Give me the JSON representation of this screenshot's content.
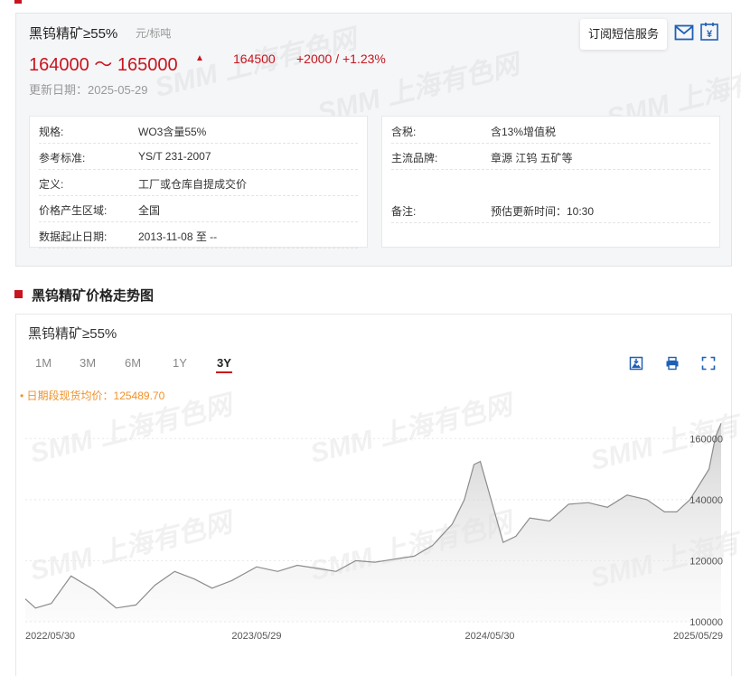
{
  "product": {
    "title": "黑钨精矿≥55%",
    "unit": "元/标吨",
    "price_range": "164000 ～ 165000",
    "avg_price": "164500",
    "change": "+2000 / +1.23%",
    "update_date": "更新日期：2025-05-29",
    "subscribe_label": "订阅短信服务"
  },
  "specs_left": [
    {
      "key": "规格:",
      "value": "WO3含量55%"
    },
    {
      "key": "参考标准:",
      "value": "YS/T 231-2007"
    },
    {
      "key": "定义:",
      "value": "工厂或仓库自提成交价"
    },
    {
      "key": "价格产生区域:",
      "value": "全国"
    },
    {
      "key": "数据起止日期:",
      "value": "2013-11-08 至 --"
    }
  ],
  "specs_right": [
    {
      "key": "含税:",
      "value": "含13%增值税"
    },
    {
      "key": "主流品牌:",
      "value": "章源 江钨 五矿等"
    },
    {
      "key": "备注:",
      "value": "预估更新时间：10:30"
    }
  ],
  "section_title": "黑钨精矿价格走势图",
  "chart_panel": {
    "title": "黑钨精矿≥55%",
    "ranges": [
      "1M",
      "3M",
      "6M",
      "1Y",
      "3Y"
    ],
    "active_range": "3Y",
    "avg_note": "• 日期段现货均价：125489.70",
    "watermark": "SMM 上海有色网"
  },
  "colors": {
    "accent": "#c8141e",
    "note": "#f0922a",
    "line": "#8c8c8c"
  },
  "chart_data": {
    "type": "area",
    "x_ticks": [
      "2022/05/30",
      "2023/05/29",
      "2024/05/30",
      "2025/05/29"
    ],
    "y_ticks": [
      100000,
      120000,
      140000,
      160000
    ],
    "ylim": [
      100000,
      166000
    ],
    "grid": true,
    "series": [
      {
        "x": [
          "2022/05/30",
          "2022/06/15",
          "2022/07/10",
          "2022/08/10",
          "2022/09/15",
          "2022/10/20",
          "2022/11/20",
          "2022/12/20",
          "2023/01/20",
          "2023/02/20",
          "2023/03/20",
          "2023/04/20",
          "2023/05/29",
          "2023/07/01",
          "2023/08/01",
          "2023/09/01",
          "2023/10/01",
          "2023/11/01",
          "2023/12/01",
          "2024/01/01",
          "2024/02/01",
          "2024/03/01",
          "2024/04/01",
          "2024/04/20",
          "2024/05/05",
          "2024/05/15",
          "2024/06/01",
          "2024/06/20",
          "2024/07/10",
          "2024/08/01",
          "2024/09/01",
          "2024/10/01",
          "2024/11/01",
          "2024/12/01",
          "2025/01/01",
          "2025/02/01",
          "2025/03/01",
          "2025/03/20",
          "2025/04/10",
          "2025/04/25",
          "2025/05/10",
          "2025/05/20",
          "2025/05/29"
        ],
        "values": [
          107500,
          104500,
          106000,
          115000,
          110500,
          104500,
          105500,
          112000,
          116500,
          114000,
          111000,
          113500,
          118000,
          116500,
          118500,
          117500,
          116500,
          120000,
          119500,
          120500,
          121500,
          125000,
          132000,
          140000,
          151500,
          152500,
          140000,
          126000,
          128000,
          134000,
          133000,
          138500,
          139000,
          137500,
          141500,
          140000,
          136000,
          136000,
          140000,
          145000,
          150000,
          160500,
          165000
        ]
      }
    ]
  }
}
